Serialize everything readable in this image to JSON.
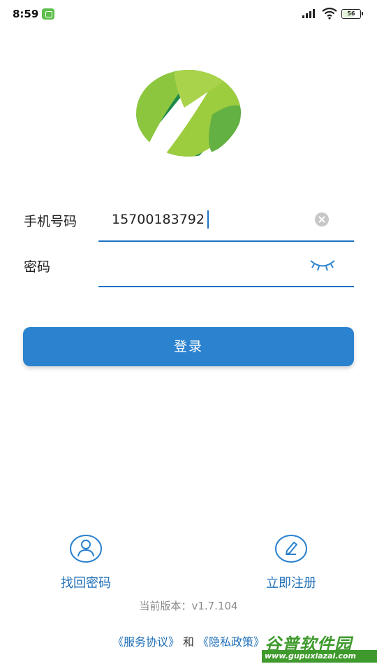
{
  "status_bar": {
    "time": "8:59",
    "battery": "56",
    "battery_level": 0.56,
    "app_icon": "android-robot-icon"
  },
  "form": {
    "phone_label": "手机号码",
    "phone_value": "15700183792",
    "password_label": "密码",
    "password_value": ""
  },
  "login_button": "登录",
  "actions": {
    "find_password": "找回密码",
    "register": "立即注册"
  },
  "version": {
    "label": "当前版本：",
    "number": "v1.7.104"
  },
  "agreement": {
    "service": "《服务协议》",
    "and": "和",
    "privacy": "《隐私政策》"
  },
  "watermark": {
    "title": "谷普软件园",
    "url": "www.gupuxiazai.com"
  },
  "colors": {
    "accent": "#2b82cf",
    "link": "#1f6fb8",
    "logo_light": "#8cc63f",
    "logo_dark": "#1e8a4c"
  }
}
